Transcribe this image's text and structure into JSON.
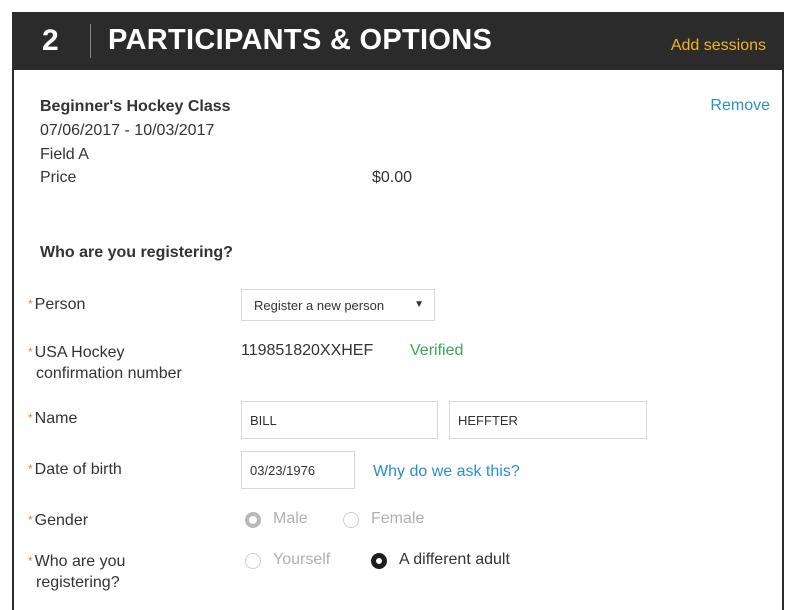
{
  "header": {
    "step": "2",
    "title": "PARTICIPANTS & OPTIONS",
    "add_sessions": "Add sessions"
  },
  "course": {
    "name": "Beginner's Hockey Class",
    "dates": "07/06/2017 - 10/03/2017",
    "field": "Field A",
    "price_label": "Price",
    "price_value": "$0.00",
    "remove": "Remove"
  },
  "form": {
    "question": "Who are you registering?",
    "person": {
      "label": "Person",
      "selected": "Register a new person"
    },
    "usa_hockey": {
      "label_line1": "USA Hockey",
      "label_line2": "confirmation number",
      "value": "119851820XXHEF",
      "status": "Verified"
    },
    "name": {
      "label": "Name",
      "first": "BILL",
      "last": "HEFFTER"
    },
    "dob": {
      "label": "Date of birth",
      "value": "03/23/1976",
      "why": "Why do we ask this?"
    },
    "gender": {
      "label": "Gender",
      "options": [
        "Male",
        "Female"
      ],
      "selected": "Male"
    },
    "who": {
      "label_line1": "Who are you",
      "label_line2": "registering?",
      "options": [
        "Yourself",
        "A different adult"
      ],
      "selected": "A different adult"
    }
  },
  "colors": {
    "header_bg": "#2b2b2b",
    "accent_gold": "#f0b429",
    "link_blue": "#2a8fcb",
    "verified_green": "#3aa655",
    "required_orange": "#e8842c"
  }
}
